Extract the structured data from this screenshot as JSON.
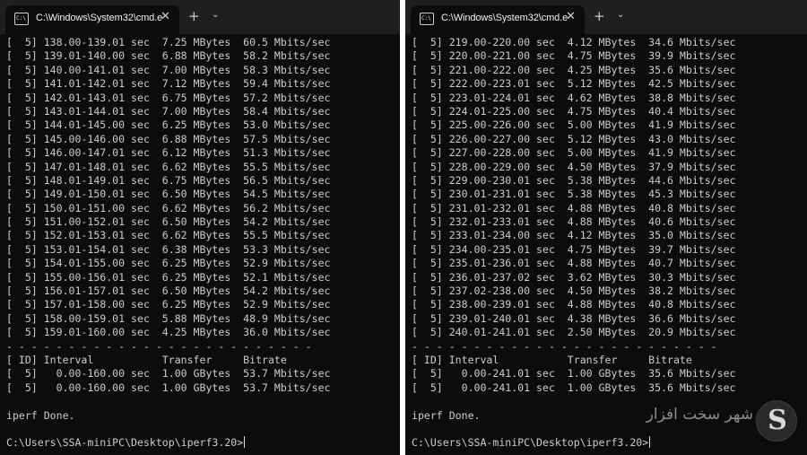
{
  "left_window": {
    "tab_title": "C:\\Windows\\System32\\cmd.e",
    "icon_text": "C:\\",
    "close_glyph": "✕",
    "add_glyph": "+",
    "dropdown_glyph": "⌄",
    "lines": [
      "[  5] 138.00-139.01 sec  7.25 MBytes  60.5 Mbits/sec",
      "[  5] 139.01-140.00 sec  6.88 MBytes  58.2 Mbits/sec",
      "[  5] 140.00-141.01 sec  7.00 MBytes  58.3 Mbits/sec",
      "[  5] 141.01-142.01 sec  7.12 MBytes  59.4 Mbits/sec",
      "[  5] 142.01-143.01 sec  6.75 MBytes  57.2 Mbits/sec",
      "[  5] 143.01-144.01 sec  7.00 MBytes  58.4 Mbits/sec",
      "[  5] 144.01-145.00 sec  6.25 MBytes  53.0 Mbits/sec",
      "[  5] 145.00-146.00 sec  6.88 MBytes  57.5 Mbits/sec",
      "[  5] 146.00-147.01 sec  6.12 MBytes  51.3 Mbits/sec",
      "[  5] 147.01-148.01 sec  6.62 MBytes  55.5 Mbits/sec",
      "[  5] 148.01-149.01 sec  6.75 MBytes  56.5 Mbits/sec",
      "[  5] 149.01-150.01 sec  6.50 MBytes  54.5 Mbits/sec",
      "[  5] 150.01-151.00 sec  6.62 MBytes  56.2 Mbits/sec",
      "[  5] 151.00-152.01 sec  6.50 MBytes  54.2 Mbits/sec",
      "[  5] 152.01-153.01 sec  6.62 MBytes  55.5 Mbits/sec",
      "[  5] 153.01-154.01 sec  6.38 MBytes  53.3 Mbits/sec",
      "[  5] 154.01-155.00 sec  6.25 MBytes  52.9 Mbits/sec",
      "[  5] 155.00-156.01 sec  6.25 MBytes  52.1 Mbits/sec",
      "[  5] 156.01-157.01 sec  6.50 MBytes  54.2 Mbits/sec",
      "[  5] 157.01-158.00 sec  6.25 MBytes  52.9 Mbits/sec",
      "[  5] 158.00-159.01 sec  5.88 MBytes  48.9 Mbits/sec",
      "[  5] 159.01-160.00 sec  4.25 MBytes  36.0 Mbits/sec",
      "- - - - - - - - - - - - - - - - - - - - - - - - -",
      "[ ID] Interval           Transfer     Bitrate",
      "[  5]   0.00-160.00 sec  1.00 GBytes  53.7 Mbits/sec",
      "[  5]   0.00-160.00 sec  1.00 GBytes  53.7 Mbits/sec",
      "",
      "iperf Done.",
      "",
      "C:\\Users\\SSA-miniPC\\Desktop\\iperf3.20>"
    ]
  },
  "right_window": {
    "tab_title": "C:\\Windows\\System32\\cmd.e",
    "icon_text": "C:\\",
    "close_glyph": "✕",
    "add_glyph": "+",
    "dropdown_glyph": "⌄",
    "lines": [
      "[  5] 219.00-220.00 sec  4.12 MBytes  34.6 Mbits/sec",
      "[  5] 220.00-221.00 sec  4.75 MBytes  39.9 Mbits/sec",
      "[  5] 221.00-222.00 sec  4.25 MBytes  35.6 Mbits/sec",
      "[  5] 222.00-223.01 sec  5.12 MBytes  42.5 Mbits/sec",
      "[  5] 223.01-224.01 sec  4.62 MBytes  38.8 Mbits/sec",
      "[  5] 224.01-225.00 sec  4.75 MBytes  40.4 Mbits/sec",
      "[  5] 225.00-226.00 sec  5.00 MBytes  41.9 Mbits/sec",
      "[  5] 226.00-227.00 sec  5.12 MBytes  43.0 Mbits/sec",
      "[  5] 227.00-228.00 sec  5.00 MBytes  41.9 Mbits/sec",
      "[  5] 228.00-229.00 sec  4.50 MBytes  37.9 Mbits/sec",
      "[  5] 229.00-230.01 sec  5.38 MBytes  44.6 Mbits/sec",
      "[  5] 230.01-231.01 sec  5.38 MBytes  45.3 Mbits/sec",
      "[  5] 231.01-232.01 sec  4.88 MBytes  40.8 Mbits/sec",
      "[  5] 232.01-233.01 sec  4.88 MBytes  40.6 Mbits/sec",
      "[  5] 233.01-234.00 sec  4.12 MBytes  35.0 Mbits/sec",
      "[  5] 234.00-235.01 sec  4.75 MBytes  39.7 Mbits/sec",
      "[  5] 235.01-236.01 sec  4.88 MBytes  40.7 Mbits/sec",
      "[  5] 236.01-237.02 sec  3.62 MBytes  30.3 Mbits/sec",
      "[  5] 237.02-238.00 sec  4.50 MBytes  38.2 Mbits/sec",
      "[  5] 238.00-239.01 sec  4.88 MBytes  40.8 Mbits/sec",
      "[  5] 239.01-240.01 sec  4.38 MBytes  36.6 Mbits/sec",
      "[  5] 240.01-241.01 sec  2.50 MBytes  20.9 Mbits/sec",
      "- - - - - - - - - - - - - - - - - - - - - - - - -",
      "[ ID] Interval           Transfer     Bitrate",
      "[  5]   0.00-241.01 sec  1.00 GBytes  35.6 Mbits/sec",
      "[  5]   0.00-241.01 sec  1.00 GBytes  35.6 Mbits/sec",
      "",
      "iperf Done.",
      "",
      "C:\\Users\\SSA-miniPC\\Desktop\\iperf3.20>"
    ]
  },
  "watermark": {
    "logo_letter": "S",
    "brand_text": "شهر سخت افزار"
  }
}
